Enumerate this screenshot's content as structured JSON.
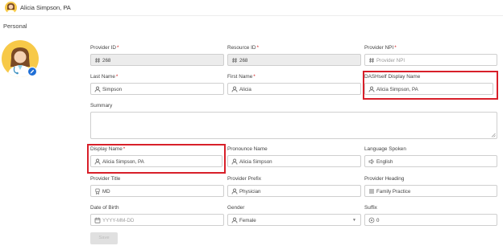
{
  "header": {
    "user_name": "Alicia Simpson, PA"
  },
  "section": {
    "title": "Personal"
  },
  "form": {
    "provider_id": {
      "label": "Provider ID",
      "value": "268"
    },
    "resource_id": {
      "label": "Resource ID",
      "value": "268"
    },
    "provider_npi": {
      "label": "Provider NPI",
      "placeholder": "Provider NPI"
    },
    "last_name": {
      "label": "Last Name",
      "value": "Simpson"
    },
    "first_name": {
      "label": "First Name",
      "value": "Alicia"
    },
    "dashelf_display_name": {
      "label": "DASHself Display Name",
      "value": "Alicia Simpson, PA"
    },
    "summary": {
      "label": "Summary",
      "value": ""
    },
    "display_name": {
      "label": "Display Name",
      "value": "Alicia Simpson, PA"
    },
    "pronounce_name": {
      "label": "Pronounce Name",
      "value": "Alicia Simpson"
    },
    "language_spoken": {
      "label": "Language Spoken",
      "value": "English"
    },
    "provider_title": {
      "label": "Provider Title",
      "value": "MD"
    },
    "provider_prefix": {
      "label": "Provider Prefix",
      "value": "Physician"
    },
    "provider_heading": {
      "label": "Provider Heading",
      "value": "Family Practice"
    },
    "date_of_birth": {
      "label": "Date of Birth",
      "placeholder": "YYYY-MM-DD"
    },
    "gender": {
      "label": "Gender",
      "value": "Female"
    },
    "suffix": {
      "label": "Suffix",
      "value": "0"
    },
    "required_mark": "*",
    "save_label": "Save"
  },
  "colors": {
    "accent": "#1f6fd6",
    "highlight": "#d8202a",
    "required": "#d21d1d",
    "avatar_bg": "#f7c948"
  }
}
